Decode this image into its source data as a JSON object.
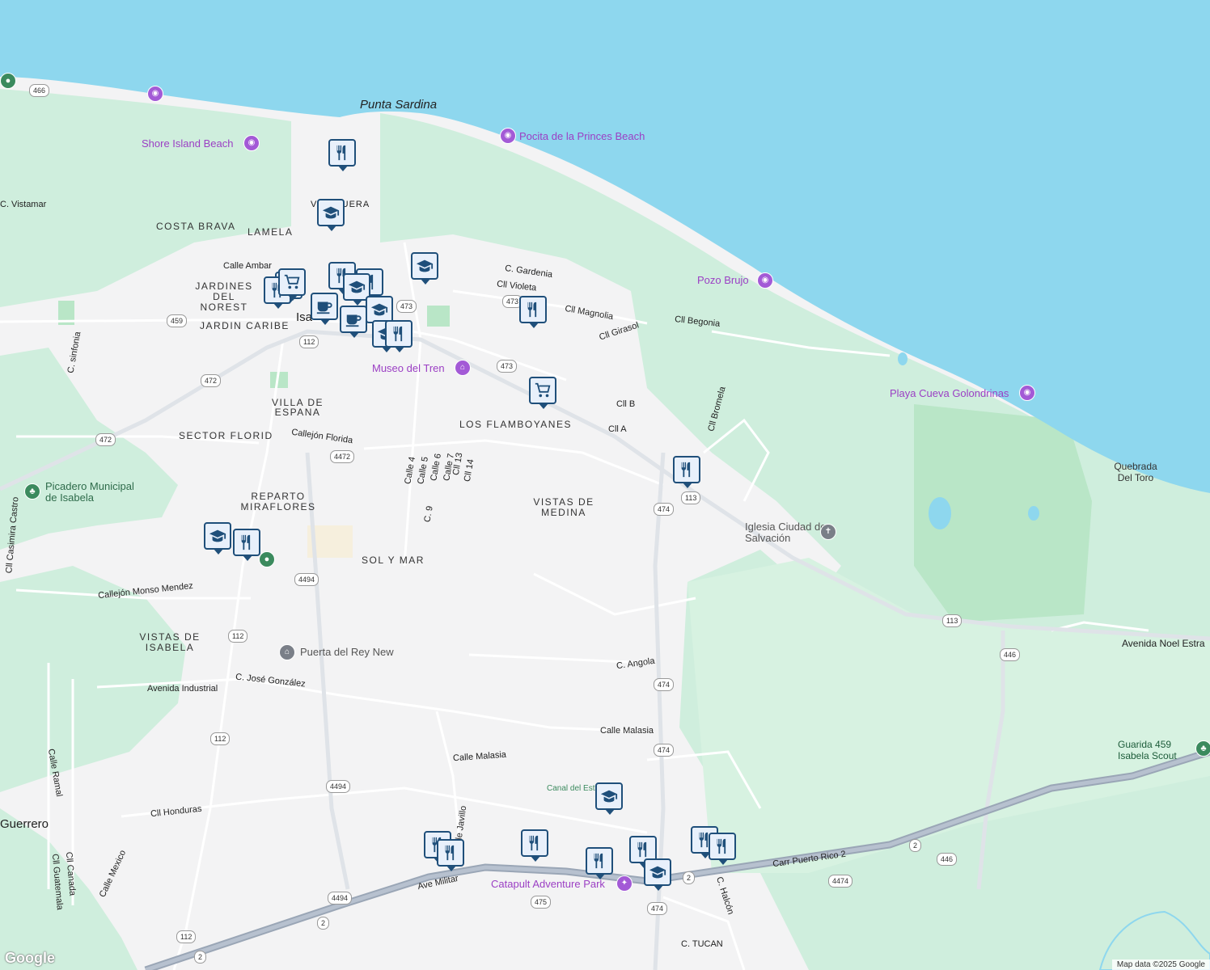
{
  "map": {
    "colors": {
      "water": "#8ed7ee",
      "land": "#f3f3f4",
      "green": "#cfeedd",
      "road": "#ffffff",
      "highway": "#9aa6b6",
      "marker_border": "#1f4f7a",
      "poi": "#9b3fc4"
    },
    "attribution": "Map data ©2025 Google",
    "logo": "Google"
  },
  "labels": {
    "places": [
      {
        "name": "Punta Sardina"
      },
      {
        "name": "Quebrada Del Toro"
      },
      {
        "name": "Guerrero"
      },
      {
        "name": "Isa"
      }
    ],
    "neighborhoods": [
      {
        "name": "COSTA BRAVA"
      },
      {
        "name": "LAMELA"
      },
      {
        "name": "JARDINES DEL NOREST"
      },
      {
        "name": "JARDIN CARIBE"
      },
      {
        "name": "VILLA DE ESPANA"
      },
      {
        "name": "SECTOR FLORID"
      },
      {
        "name": "LOS FLAMBOYANES"
      },
      {
        "name": "REPARTO MIRAFLORES"
      },
      {
        "name": "SOL Y MAR"
      },
      {
        "name": "VISTAS DE MEDINA"
      },
      {
        "name": "VISTAS DE ISABELA"
      },
      {
        "name": "V  ESQUERA"
      }
    ],
    "pois": [
      {
        "name": "Shore Island Beach"
      },
      {
        "name": "Pocita de la Princes Beach"
      },
      {
        "name": "Pozo Brujo"
      },
      {
        "name": "Playa Cueva Golondrinas"
      },
      {
        "name": "Museo del Tren"
      },
      {
        "name": "Catapult Adventure Park"
      }
    ],
    "parks": [
      {
        "name": "Picadero Municipal de Isabela"
      },
      {
        "name": "Guarida 459 Isabela Scout"
      },
      {
        "name": "Canal del Est"
      }
    ],
    "others": [
      {
        "name": "Iglesia Ciudad de Salvación"
      },
      {
        "name": "Puerta del Rey New"
      }
    ],
    "streets": [
      "C. Vistamar",
      "Calle Ambar",
      "C. Gardenia",
      "Cll Violeta",
      "Cll Magnolia",
      "Cll Girasol",
      "Cll Begonia",
      "C. sinfonia",
      "Cll B",
      "Cll A",
      "Cll Bromela",
      "Callejón Florida",
      "Calle 4",
      "Calle 5",
      "Calle 6",
      "Calle 7",
      "Cll 13",
      "Cll 14",
      "C. 9",
      "Cll Casimira Castro",
      "Callejón Monso Mendez",
      "Avenida Industrial",
      "C. José González",
      "C. Angola",
      "Calle Malasia",
      "Calle Malasia",
      "Calle Ramal",
      "Cll Honduras",
      "Calle Mexico",
      "Cll Guatemala",
      "Cll Canada",
      "Calle Javillo",
      "Ave Militar",
      "Carr Puerto Rico 2",
      "C. Halcón",
      "C. TUCAN",
      "Avenida Noel Estra"
    ],
    "route_shields": [
      "466",
      "459",
      "112",
      "472",
      "472",
      "473",
      "473",
      "473",
      "4472",
      "113",
      "474",
      "474",
      "474",
      "474",
      "4494",
      "4494",
      "4494",
      "112",
      "112",
      "112",
      "113",
      "446",
      "446",
      "4474",
      "2",
      "2",
      "2",
      "2",
      "475"
    ]
  },
  "markers": [
    {
      "type": "restaurant",
      "icon": "fork-knife-icon"
    },
    {
      "type": "school",
      "icon": "graduation-cap-icon"
    },
    {
      "type": "school",
      "icon": "graduation-cap-icon"
    },
    {
      "type": "restaurant",
      "icon": "fork-knife-icon"
    },
    {
      "type": "restaurant",
      "icon": "fork-knife-icon"
    },
    {
      "type": "school",
      "icon": "graduation-cap-icon"
    },
    {
      "type": "shopping",
      "icon": "cart-icon"
    },
    {
      "type": "restaurant",
      "icon": "fork-knife-icon"
    },
    {
      "type": "cafe",
      "icon": "coffee-cup-icon"
    },
    {
      "type": "cafe",
      "icon": "coffee-cup-icon"
    },
    {
      "type": "school",
      "icon": "graduation-cap-icon"
    },
    {
      "type": "restaurant",
      "icon": "fork-knife-icon"
    },
    {
      "type": "school",
      "icon": "graduation-cap-icon"
    },
    {
      "type": "restaurant",
      "icon": "fork-knife-icon"
    },
    {
      "type": "shopping",
      "icon": "cart-icon"
    },
    {
      "type": "shopping",
      "icon": "cart-icon"
    },
    {
      "type": "restaurant",
      "icon": "fork-knife-icon"
    },
    {
      "type": "school",
      "icon": "graduation-cap-icon"
    },
    {
      "type": "restaurant",
      "icon": "fork-knife-icon"
    },
    {
      "type": "school",
      "icon": "graduation-cap-icon"
    },
    {
      "type": "restaurant",
      "icon": "fork-knife-icon"
    },
    {
      "type": "restaurant",
      "icon": "fork-knife-icon"
    },
    {
      "type": "restaurant",
      "icon": "fork-knife-icon"
    },
    {
      "type": "restaurant",
      "icon": "fork-knife-icon"
    },
    {
      "type": "restaurant",
      "icon": "fork-knife-icon"
    },
    {
      "type": "school",
      "icon": "graduation-cap-icon"
    },
    {
      "type": "restaurant",
      "icon": "fork-knife-icon"
    },
    {
      "type": "restaurant",
      "icon": "fork-knife-icon"
    }
  ]
}
